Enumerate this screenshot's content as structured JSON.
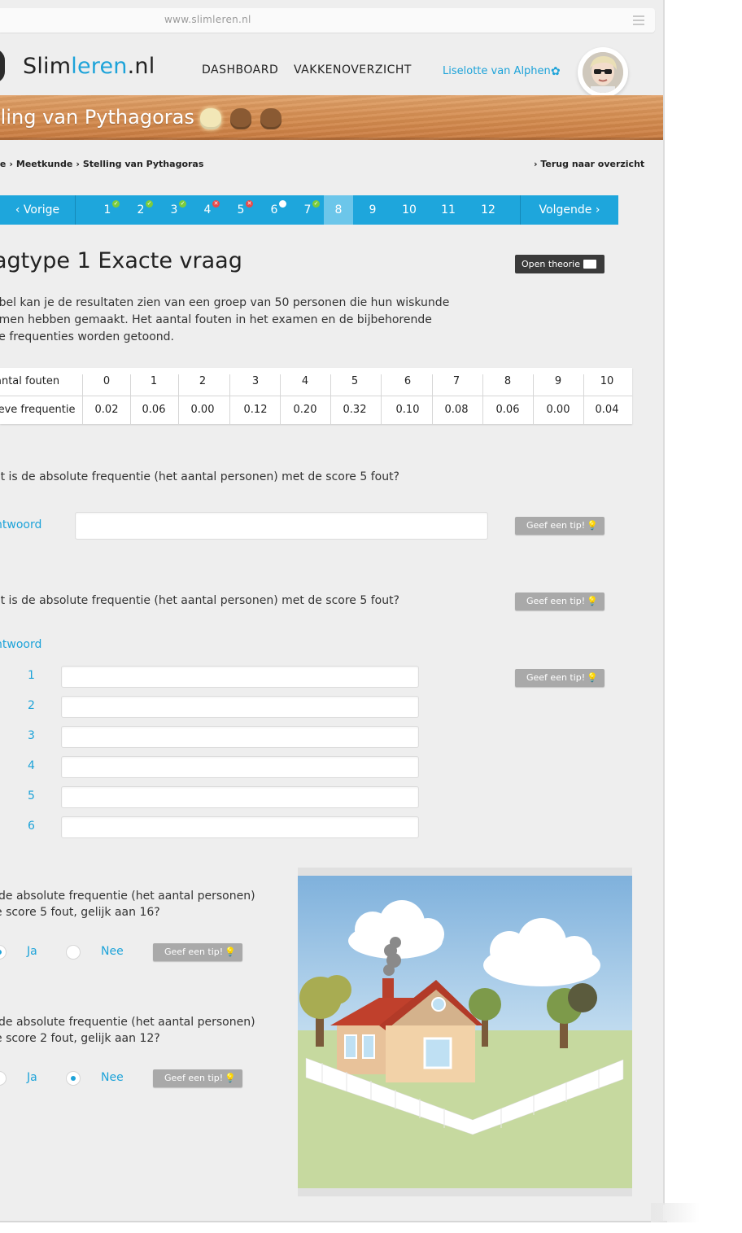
{
  "browser": {
    "url": "www.slimleren.nl"
  },
  "header": {
    "logo_prefix": "Slim",
    "logo_accent": "leren",
    "logo_suffix": ".nl",
    "nav": [
      "DASHBOARD",
      "VAKKENOVERZICHT"
    ],
    "user_name": "Liselotte van Alphen"
  },
  "banner": {
    "title": "lling van Pythagoras",
    "pots_total": 3,
    "pots_earned": 1
  },
  "breadcrumb": {
    "items": [
      "de",
      "Meetkunde",
      "Stelling van Pythagoras"
    ],
    "back": "Terug naar overzicht"
  },
  "question_nav": {
    "prev": "Vorige",
    "next": "Volgende",
    "items": [
      {
        "label": "1",
        "status": "correct"
      },
      {
        "label": "2",
        "status": "correct"
      },
      {
        "label": "3",
        "status": "correct"
      },
      {
        "label": "4",
        "status": "wrong"
      },
      {
        "label": "5",
        "status": "wrong"
      },
      {
        "label": "6",
        "status": "open"
      },
      {
        "label": "7",
        "status": "correct"
      },
      {
        "label": "8",
        "status": "current"
      },
      {
        "label": "9",
        "status": "none"
      },
      {
        "label": "10",
        "status": "none"
      },
      {
        "label": "11",
        "status": "none"
      },
      {
        "label": "12",
        "status": "none"
      }
    ]
  },
  "question": {
    "title": "agtype 1  Exacte vraag",
    "open_theory": "Open theorie",
    "intro_lines": [
      "abel kan je de resultaten zien van een groep van 50 personen die hun wiskunde",
      "amen hebben gemaakt. Het aantal fouten in het examen en de bijbehorende",
      "ve frequenties worden getoond."
    ]
  },
  "table": {
    "row1_label": "antal fouten",
    "row2_label": "ieve frequentie",
    "headers": [
      "0",
      "1",
      "2",
      "3",
      "4",
      "5",
      "6",
      "7",
      "8",
      "9",
      "10"
    ],
    "values": [
      "0.02",
      "0.06",
      "0.00",
      "0.12",
      "0.20",
      "0.32",
      "0.10",
      "0.08",
      "0.06",
      "0.00",
      "0.04"
    ]
  },
  "q1": {
    "text": "at is de absolute frequentie (het aantal personen) met de score 5 fout?",
    "answer_label": "ntwoord",
    "answer_value": "",
    "tip": "Geef een tip!"
  },
  "q2": {
    "text": "at is de absolute frequentie (het aantal personen) met de score 5 fout?",
    "answer_label": "ntwoord",
    "tip": "Geef een tip!",
    "tip2": "Geef een tip!",
    "rows": [
      "1",
      "2",
      "3",
      "4",
      "5",
      "6"
    ]
  },
  "q3": {
    "line1": "de absolute frequentie (het aantal personen)",
    "line2": "e score 5 fout, gelijk aan 16?",
    "yes": "Ja",
    "no": "Nee",
    "selected": "Ja",
    "tip": "Geef een tip!"
  },
  "q4": {
    "line1": "de absolute frequentie (het aantal personen)",
    "line2": "e score 2 fout, gelijk aan 12?",
    "yes": "Ja",
    "no": "Nee",
    "selected": "Nee",
    "tip": "Geef een tip!"
  },
  "colors": {
    "accent": "#1da3d9",
    "nav_bg": "#1ea6dc",
    "correct": "#7ccc3c",
    "wrong": "#e84a4a",
    "wood": "#d68f53"
  },
  "icons": [
    "menu-icon",
    "gear-icon",
    "chevron-left-icon",
    "chevron-right-icon",
    "book-icon",
    "lightbulb-icon",
    "check-icon",
    "cross-icon"
  ]
}
